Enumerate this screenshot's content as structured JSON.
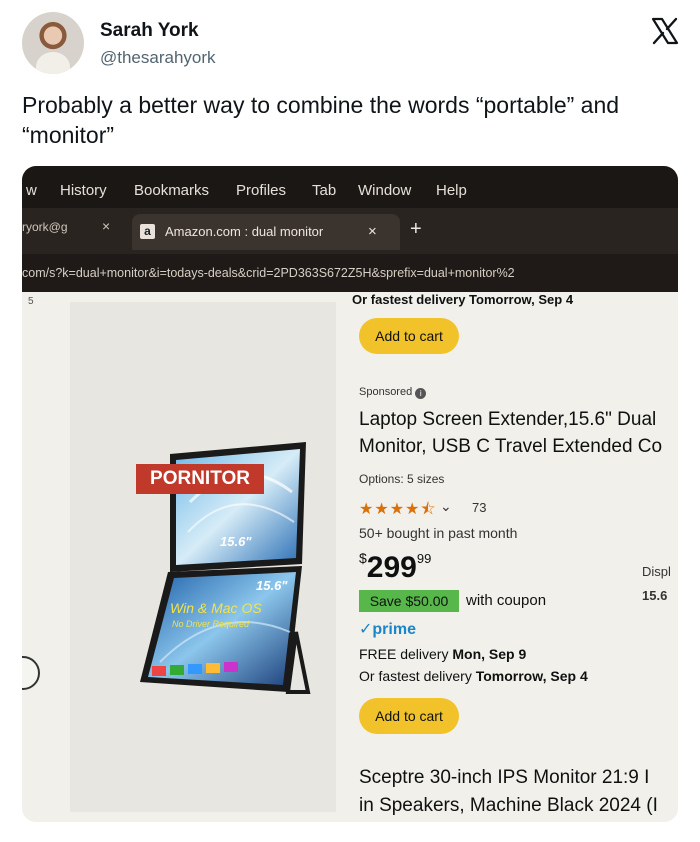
{
  "tweet": {
    "name": "Sarah York",
    "handle": "@thesarahyork",
    "text": "Probably a better way to combine the words “portable” and “monitor”"
  },
  "browser": {
    "menu": [
      "w",
      "History",
      "Bookmarks",
      "Profiles",
      "Tab",
      "Window",
      "Help"
    ],
    "tab_prev": "ryork@g",
    "tab_prev_close": "×",
    "tab_icon": "a",
    "tab_title": "Amazon.com : dual monitor",
    "tab_close": "×",
    "new_tab": "+",
    "url": "com/s?k=dual+monitor&i=todays-deals&crid=2PD363S672Z5H&sprefix=dual+monitor%2"
  },
  "page": {
    "left_mark": "5",
    "prev_delivery": "Or fastest delivery Tomorrow, Sep 4",
    "add_to_cart": "Add to cart",
    "sponsored": "Sponsored",
    "product_title_line1": "Laptop Screen Extender,15.6\" Dual",
    "product_title_line2": "Monitor, USB C Travel Extended Co",
    "options": "Options: 5 sizes",
    "rating_count": "73",
    "bought": "50+ bought in past month",
    "price_symbol": "$",
    "price_whole": "299",
    "price_fraction": "99",
    "save_badge": "Save $50.00",
    "coupon_text": "with coupon",
    "prime": "✓prime",
    "free_delivery_prefix": "FREE delivery",
    "free_delivery_date": "Mon, Sep 9",
    "fastest_prefix": "Or fastest delivery",
    "fastest_date": "Tomorrow, Sep 4",
    "side_disp": "Displ",
    "side_size": "15.6",
    "next_title_line1": "Sceptre 30-inch IPS Monitor 21:9 I",
    "next_title_line2": "in Speakers, Machine Black 2024 (I"
  },
  "product_image": {
    "brand": "PORNITOR",
    "size_top": "15.6\"",
    "size_bottom": "15.6\"",
    "os": "Win & Mac OS",
    "driver": "No Driver Required"
  },
  "colors": {
    "prime_blue": "#1a85c9",
    "save_green": "#58b74a",
    "cart_yellow": "#f2c22a",
    "star_orange": "#d9700a",
    "brand_red": "#c0392b"
  },
  "rating": {
    "stars": 4.5,
    "max": 5
  }
}
